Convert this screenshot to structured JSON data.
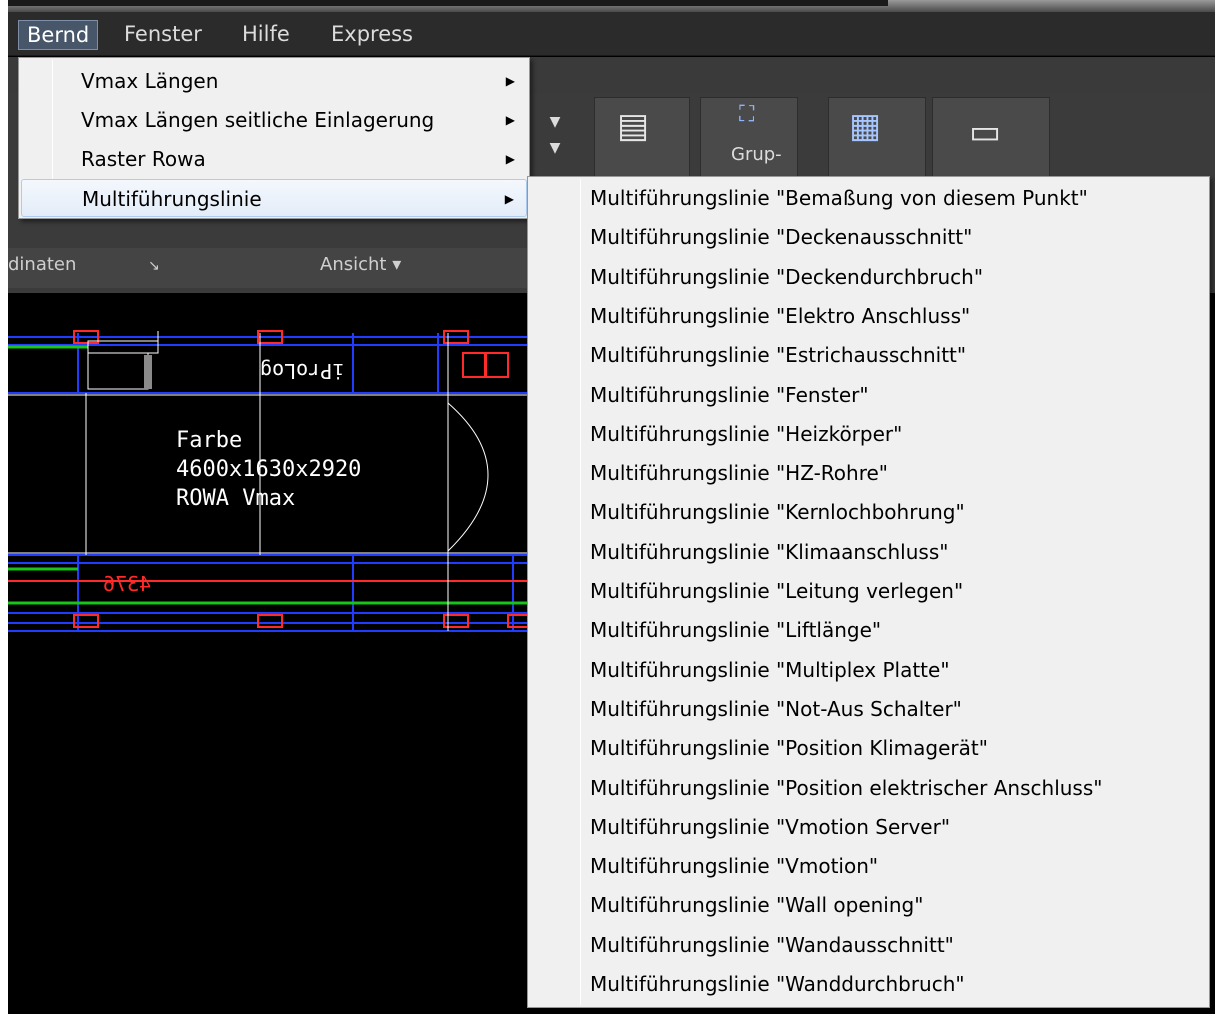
{
  "menubar": {
    "items": [
      "Bernd",
      "Fenster",
      "Hilfe",
      "Express"
    ]
  },
  "ribbon": {
    "group_button_label": "Grup-",
    "panel_left_label": "dinaten",
    "panel_view_label": "Ansicht"
  },
  "drawing": {
    "mirrored_text": "iProLog",
    "label_lines": "Farbe\n4600x1630x2920\nROWA Vmax",
    "dimension": "4376"
  },
  "main_menu": {
    "items": [
      "Vmax Längen",
      "Vmax Längen seitliche Einlagerung",
      "Raster Rowa",
      "Multiführungslinie"
    ],
    "selected_index": 3
  },
  "sub_menu": {
    "items": [
      "Multiführungslinie \"Bemaßung von diesem Punkt\"",
      "Multiführungslinie \"Deckenausschnitt\"",
      "Multiführungslinie \"Deckendurchbruch\"",
      "Multiführungslinie \"Elektro Anschluss\"",
      "Multiführungslinie \"Estrichausschnitt\"",
      "Multiführungslinie \"Fenster\"",
      "Multiführungslinie \"Heizkörper\"",
      "Multiführungslinie \"HZ-Rohre\"",
      "Multiführungslinie \"Kernlochbohrung\"",
      "Multiführungslinie \"Klimaanschluss\"",
      "Multiführungslinie \"Leitung verlegen\"",
      "Multiführungslinie \"Liftlänge\"",
      "Multiführungslinie \"Multiplex Platte\"",
      "Multiführungslinie \"Not-Aus Schalter\"",
      "Multiführungslinie \"Position Klimagerät\"",
      "Multiführungslinie \"Position elektrischer Anschluss\"",
      "Multiführungslinie \"Vmotion Server\"",
      "Multiführungslinie \"Vmotion\"",
      "Multiführungslinie \"Wall opening\"",
      "Multiführungslinie \"Wandausschnitt\"",
      "Multiführungslinie \"Wanddurchbruch\""
    ]
  },
  "colors": {
    "menu_bg": "#f0f0f0",
    "selected_bg": "#e3ecf8",
    "cad_red": "#ff2a2a",
    "cad_blue": "#1f3cff",
    "cad_green": "#19c419"
  }
}
